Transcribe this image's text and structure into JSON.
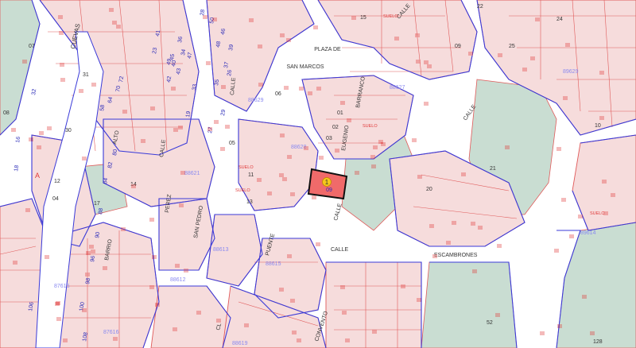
{
  "map": {
    "colors": {
      "street": "#ffffff",
      "parcel_fill": "#f6dcdc",
      "parcel_line": "#e05a5a",
      "block_line": "#3a3ad8",
      "green": "#c9ddd2",
      "highlight_fill": "#f06a6a",
      "highlight_line": "#111111",
      "marker": "#f5c81a",
      "block_code": "#8a8af0",
      "number": "#2a2ab8",
      "street_text": "#333333"
    },
    "streets": {
      "plaza": [
        "PLAZA DE",
        "SAN MARCOS"
      ],
      "cuevas": "CUEVAS",
      "calle_left": "CALLE",
      "barranco": "BARRANCO",
      "eugenio": "EUGENIO",
      "calle_right": "CALLE",
      "calle_main": "CALLE",
      "escambrones": "ESCAMBRONES",
      "calle_lower": "CALLE",
      "puente": "PUENTE",
      "san_pedro": "SAN PEDRO",
      "calle_12": "CALLE",
      "calle_a": "A",
      "barrio": "BARRIO",
      "alto": "ALTO",
      "cl": "CL",
      "convento": "CONVENTO",
      "perez": "PEREZ",
      "calle_mid": "CALLE"
    },
    "block_codes": {
      "b89629": "89629",
      "b88627": "88627",
      "b88628": "88628",
      "b88629": "88629",
      "b88621": "88621",
      "b88613": "88613",
      "b88615": "88615",
      "b88612": "88612",
      "b87615": "87615",
      "b87616": "87616",
      "b88619": "88619",
      "b89614": "89614"
    },
    "subject_parcel": {
      "marker": "1",
      "number": "09"
    },
    "suelo": "SUELO",
    "numbers": {
      "n01": "07",
      "n02": "31",
      "n03": "30",
      "n04": "08",
      "n05": "16",
      "n06": "18",
      "n07": "12",
      "n08": "04",
      "n09": "17",
      "n10": "14",
      "n11": "11",
      "n12": "15",
      "n13": "06",
      "n14": "13",
      "n15": "10",
      "n16": "05",
      "n17": "03",
      "n18": "02",
      "n19": "01",
      "n20": "09",
      "n21": "20",
      "n22": "21",
      "n23": "22",
      "n24": "24",
      "n25": "25",
      "n26": "28",
      "n27": "34",
      "n28": "36",
      "n29": "40",
      "n30": "42",
      "n31": "46",
      "n32": "48",
      "n33": "52",
      "n34": "58",
      "n35": "64",
      "n36": "70",
      "n37": "72",
      "n38": "80",
      "n39": "82",
      "n40": "84",
      "n41": "88",
      "n42": "90",
      "n43": "96",
      "n44": "98",
      "n45": "100",
      "n46": "106",
      "n47": "108",
      "n48": "128",
      "n49": "33",
      "n50": "35",
      "n51": "37",
      "n52": "39",
      "n53": "43",
      "n54": "45",
      "n55": "47",
      "n56": "49",
      "n57": "19",
      "n58": "23",
      "n59": "26",
      "n60": "27",
      "n61": "29",
      "n62": "32",
      "n63": "41",
      "n64": "50"
    }
  }
}
